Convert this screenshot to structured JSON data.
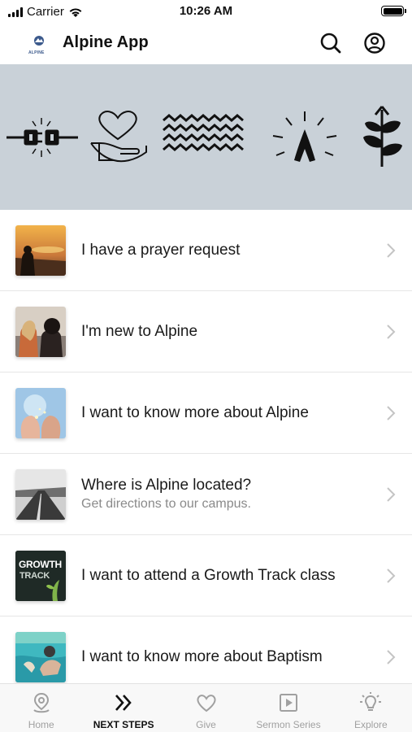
{
  "status_bar": {
    "carrier": "Carrier",
    "time": "10:26 AM"
  },
  "header": {
    "logo_text": "ALPINE",
    "title": "Alpine App",
    "icons": [
      "search-icon",
      "account-icon"
    ]
  },
  "banner": {
    "icons": [
      "plug-connect-icon",
      "heart-hand-icon",
      "waves-icon",
      "praying-hands-icon",
      "plant-growth-icon"
    ]
  },
  "list": {
    "items": [
      {
        "title": "I have a prayer request",
        "subtitle": "",
        "thumb": "sunset-prayer"
      },
      {
        "title": "I'm new to Alpine",
        "subtitle": "",
        "thumb": "two-women"
      },
      {
        "title": "I want to know more about Alpine",
        "subtitle": "",
        "thumb": "open-hands"
      },
      {
        "title": "Where is Alpine located?",
        "subtitle": "Get directions to our campus.",
        "thumb": "road"
      },
      {
        "title": "I want to attend a Growth Track class",
        "subtitle": "",
        "thumb": "growth-track",
        "thumb_text_1": "GROWTH",
        "thumb_text_2": "TRACK"
      },
      {
        "title": "I want to know more about Baptism",
        "subtitle": "",
        "thumb": "baptism"
      }
    ]
  },
  "tabs": [
    {
      "label": "Home",
      "icon": "map-pin-icon",
      "active": false
    },
    {
      "label": "NEXT STEPS",
      "icon": "double-chevron-icon",
      "active": true
    },
    {
      "label": "Give",
      "icon": "heart-icon",
      "active": false
    },
    {
      "label": "Sermon Series",
      "icon": "play-square-icon",
      "active": false
    },
    {
      "label": "Explore",
      "icon": "lightbulb-icon",
      "active": false
    }
  ],
  "colors": {
    "banner_bg": "#c9d1d8",
    "active_tab": "#111111",
    "inactive_tab": "#a0a0a0",
    "chevron": "#c4c4c4"
  }
}
